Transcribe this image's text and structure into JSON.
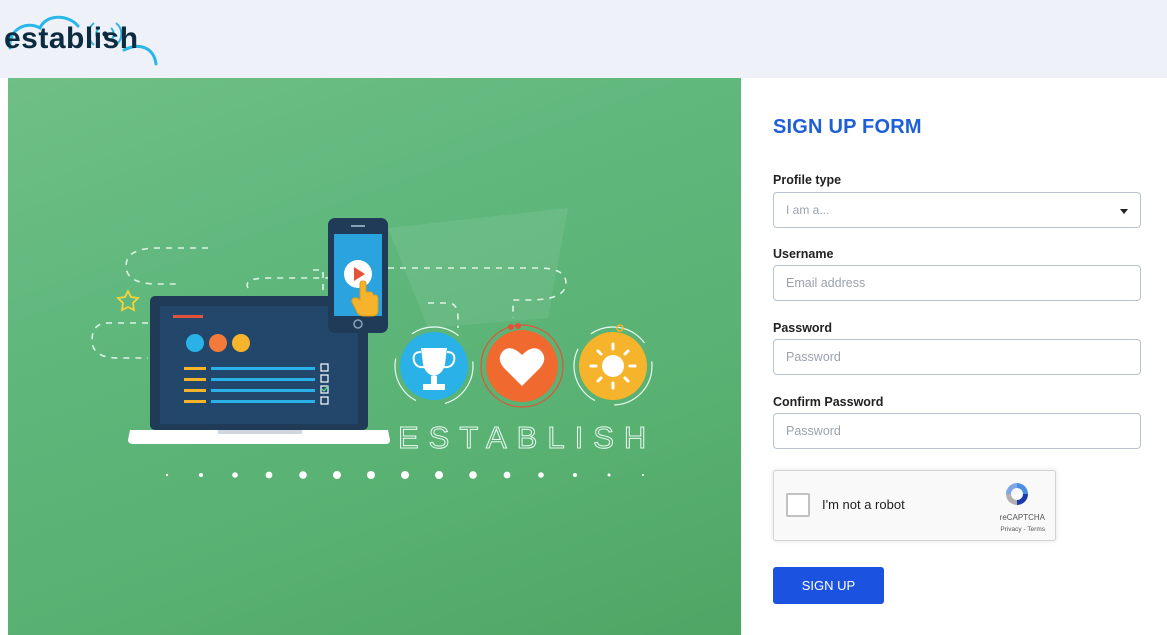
{
  "header": {
    "logo_text": "establish"
  },
  "hero": {
    "watermark": "ESTABLISH"
  },
  "form": {
    "title": "SIGN UP FORM",
    "profile_type": {
      "label": "Profile type",
      "selected": "I am a..."
    },
    "username": {
      "label": "Username",
      "placeholder": "Email address"
    },
    "password": {
      "label": "Password",
      "placeholder": "Password"
    },
    "confirm_password": {
      "label": "Confirm Password",
      "placeholder": "Password"
    },
    "captcha": {
      "label": "I'm not a robot",
      "brand": "reCAPTCHA",
      "links": "Privacy - Terms"
    },
    "submit_label": "SIGN UP"
  },
  "colors": {
    "accent": "#1b53e0",
    "title": "#1e5fd6",
    "hero_green": "#5fb77c",
    "header_bg": "#eef1f8"
  },
  "icons": [
    "cloud-wifi-logo-icon",
    "phone-icon",
    "play-icon",
    "hand-pointer-icon",
    "laptop-icon",
    "trophy-icon",
    "heart-icon",
    "sun-icon",
    "star-icon",
    "recaptcha-icon",
    "chevron-down-icon"
  ]
}
